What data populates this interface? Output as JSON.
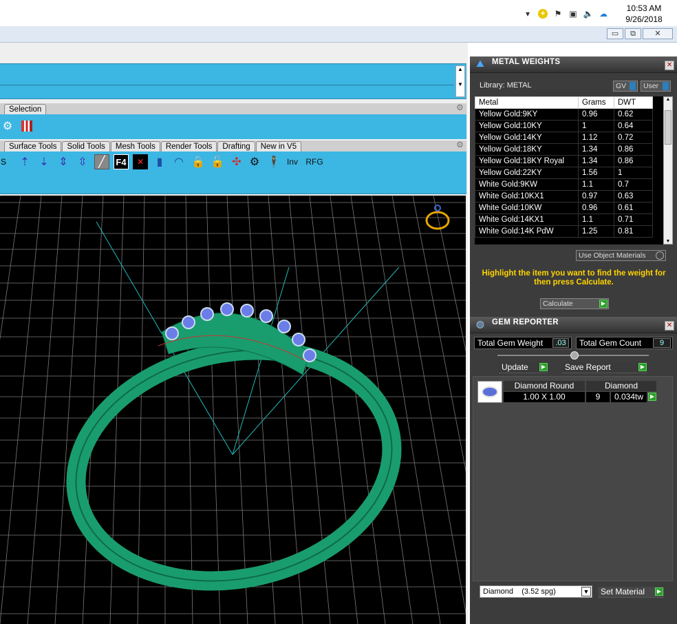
{
  "taskbar": {
    "time": "10:53 AM",
    "date": "9/26/2018"
  },
  "window_controls": {
    "minimize": "▭",
    "restore": "⧉",
    "close": "✕"
  },
  "tabs_row1": {
    "selection": "Selection"
  },
  "tabs_row2": [
    "Surface Tools",
    "Solid Tools",
    "Mesh Tools",
    "Render Tools",
    "Drafting",
    "New in V5"
  ],
  "toolbar": {
    "s_label": "S",
    "f4_label": "F4",
    "inv_label": "Inv",
    "rfg_label": "RFG"
  },
  "metal_weights": {
    "title": "METAL WEIGHTS",
    "library_label": "Library: METAL",
    "gv_label": "GV",
    "user_label": "User",
    "columns": [
      "Metal",
      "Grams",
      "DWT"
    ],
    "rows": [
      [
        "Yellow Gold:9KY",
        "0.96",
        "0.62"
      ],
      [
        "Yellow Gold:10KY",
        "1",
        "0.64"
      ],
      [
        "Yellow Gold:14KY",
        "1.12",
        "0.72"
      ],
      [
        "Yellow Gold:18KY",
        "1.34",
        "0.86"
      ],
      [
        "Yellow Gold:18KY Royal",
        "1.34",
        "0.86"
      ],
      [
        "Yellow Gold:22KY",
        "1.56",
        "1"
      ],
      [
        "White Gold:9KW",
        "1.1",
        "0.7"
      ],
      [
        "White Gold:10KX1",
        "0.97",
        "0.63"
      ],
      [
        "White Gold:10KW",
        "0.96",
        "0.61"
      ],
      [
        "White Gold:14KX1",
        "1.1",
        "0.71"
      ],
      [
        "White Gold:14K PdW",
        "1.25",
        "0.81"
      ]
    ],
    "use_object_materials": "Use Object Materials",
    "instruction": "Highlight the item you want to find the weight for then press Calculate.",
    "calculate_label": "Calculate"
  },
  "gem_reporter": {
    "title": "GEM REPORTER",
    "total_weight_label": "Total Gem Weight",
    "total_weight_value": ".03",
    "total_count_label": "Total Gem Count",
    "total_count_value": "9",
    "update_label": "Update",
    "save_report_label": "Save Report",
    "gem_shape": "Diamond Round",
    "gem_material": "Diamond",
    "gem_size": "1.00 X 1.00",
    "gem_qty": "9",
    "gem_weight": "0.034tw",
    "material_select": "Diamond    (3.52 spg)",
    "set_material_label": "Set Material"
  },
  "colors": {
    "toolbar_blue": "#3cb6e3",
    "panel_bg": "#3c3c3c",
    "ring_green": "#1a9d6e",
    "instruction_yellow": "#ffd400"
  }
}
